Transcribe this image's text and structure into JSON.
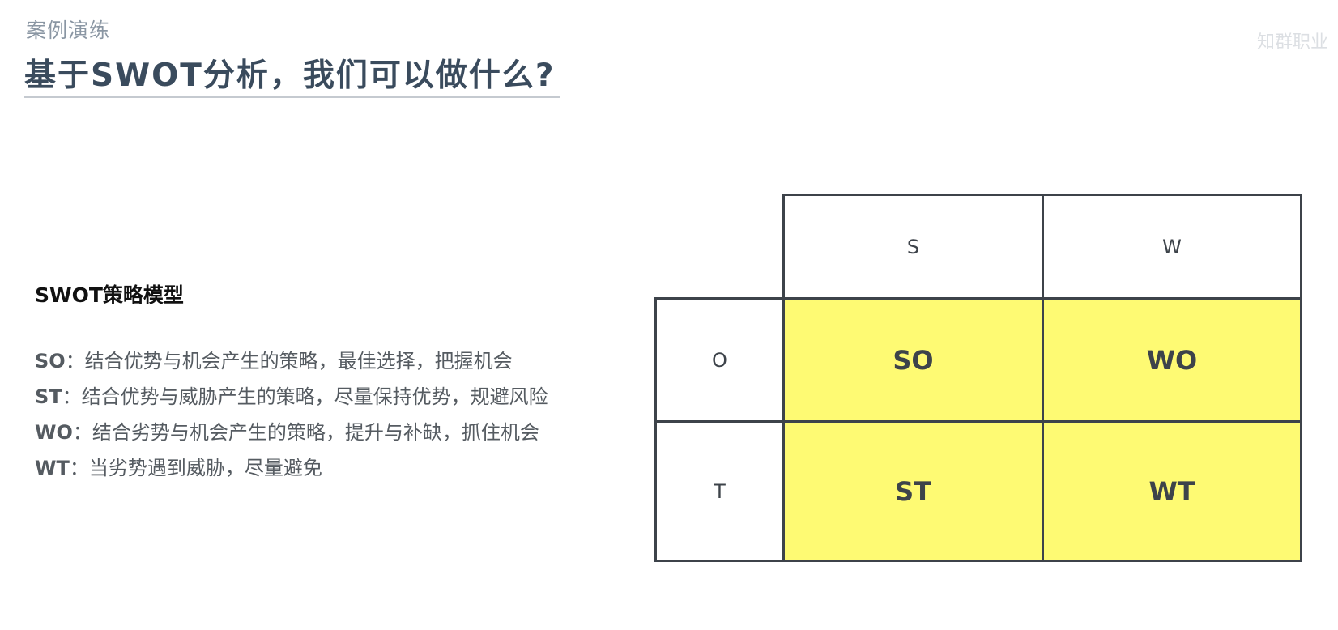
{
  "header": {
    "section_label": "案例演练",
    "title": "基于SWOT分析，我们可以做什么?",
    "watermark": "知群职业"
  },
  "model": {
    "title": "SWOT策略模型",
    "strategies": [
      {
        "code": "SO",
        "desc": "：结合优势与机会产生的策略，最佳选择，把握机会"
      },
      {
        "code": "ST",
        "desc": "：结合优势与威胁产生的策略，尽量保持优势，规避风险"
      },
      {
        "code": "WO",
        "desc": "：结合劣势与机会产生的策略，提升与补缺，抓住机会"
      },
      {
        "code": "WT",
        "desc": "：当劣势遇到威胁，尽量避免"
      }
    ]
  },
  "matrix": {
    "col_headers": [
      "S",
      "W"
    ],
    "row_headers": [
      "O",
      "T"
    ],
    "cells": [
      [
        "SO",
        "WO"
      ],
      [
        "ST",
        "WT"
      ]
    ],
    "quad_color": "#fefa73"
  }
}
